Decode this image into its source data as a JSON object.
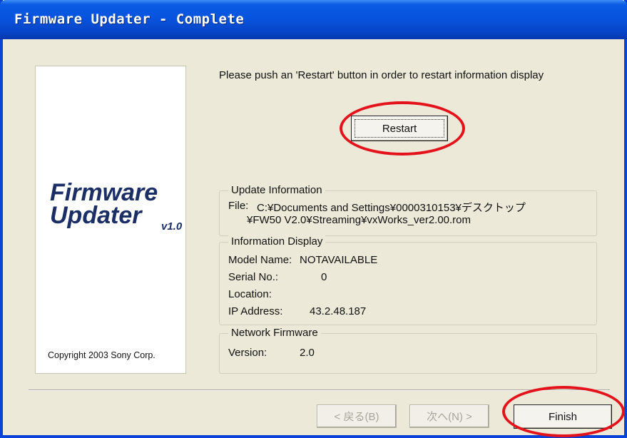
{
  "window": {
    "title": "Firmware Updater - Complete"
  },
  "banner": {
    "logo_line1": "Firmware",
    "logo_line2": "Updater",
    "logo_version": "v1.0",
    "copyright": "Copyright 2003 Sony Corp."
  },
  "message": "Please push an 'Restart' button in order to restart information display",
  "buttons": {
    "restart": "Restart",
    "back": "< 戻る(B)",
    "next": "次へ(N) >",
    "finish": "Finish"
  },
  "update_info": {
    "label": "Update Information",
    "file_label": "File:",
    "file_path_line1": "C:¥Documents and Settings¥0000310153¥デスクトップ",
    "file_path_line2": "¥FW50 V2.0¥Streaming¥vxWorks_ver2.00.rom"
  },
  "info_display": {
    "label": "Information Display",
    "model_label": "Model Name:",
    "model_value": "NOTAVAILABLE",
    "serial_label": "Serial No.:",
    "serial_value": "0",
    "location_label": "Location:",
    "location_value": "",
    "ip_label": "IP Address:",
    "ip_value": "43.2.48.187"
  },
  "network_firmware": {
    "label": "Network Firmware",
    "version_label": "Version:",
    "version_value": "2.0"
  },
  "annotations": {
    "highlight_color": "#e4121b"
  }
}
